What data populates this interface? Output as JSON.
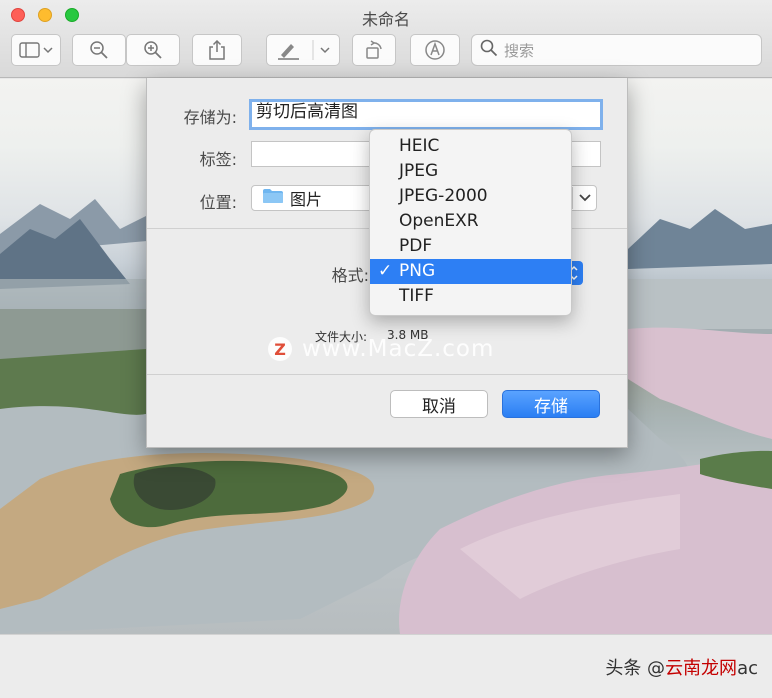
{
  "window": {
    "title": "未命名"
  },
  "toolbar": {
    "search_placeholder": "搜索",
    "icons": [
      "sidebar-icon",
      "zoom-out-icon",
      "zoom-in-icon",
      "share-icon",
      "markup-pen-icon",
      "rotate-icon",
      "annotate-icon",
      "search-icon"
    ]
  },
  "dialog": {
    "save_as_label": "存储为:",
    "save_as_value": "剪切后高清图",
    "tags_label": "标签:",
    "tags_value": "",
    "location_label": "位置:",
    "location_value": "图片",
    "format_label": "格式:",
    "file_size_label": "文件大小:",
    "file_size_value": "3.8 MB",
    "cancel_label": "取消",
    "save_label": "存储"
  },
  "format_menu": {
    "options": [
      "HEIC",
      "JPEG",
      "JPEG-2000",
      "OpenEXR",
      "PDF",
      "PNG",
      "TIFF"
    ],
    "selected": "PNG",
    "check_glyph": "✓"
  },
  "watermark": {
    "logo": "Z",
    "text": "www.MacZ.com"
  },
  "footer": {
    "prefix": "头条 @",
    "accent": "云南龙网",
    "suffix": "ac"
  },
  "colors": {
    "accent": "#2d7ff4",
    "close": "#fe5f57",
    "minimize": "#febc2e",
    "maximize": "#28c840"
  }
}
